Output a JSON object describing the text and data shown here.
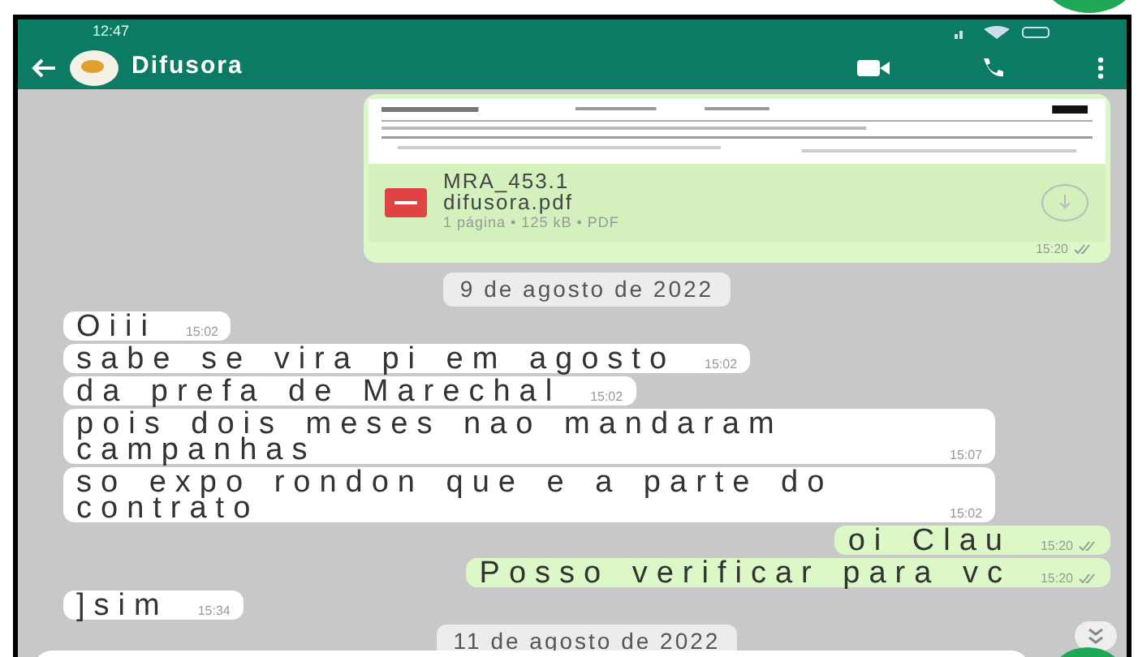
{
  "status_bar": {
    "time": "12:47"
  },
  "header": {
    "title": "Difusora"
  },
  "messages": [
    {
      "kind": "document",
      "outgoing": true,
      "name_line1": "MRA_453.1",
      "name_line2": "difusora.pdf",
      "meta": "1 página • 125 kB • PDF",
      "time": "15:20"
    },
    {
      "kind": "date",
      "text": "9 de agosto de 2022"
    },
    {
      "kind": "text",
      "outgoing": false,
      "text": "Oiii",
      "time": "15:02"
    },
    {
      "kind": "text",
      "outgoing": false,
      "text": "sabe se vira pi em agosto",
      "time": "15:02"
    },
    {
      "kind": "text",
      "outgoing": false,
      "text": "da prefa de Marechal",
      "time": "15:02"
    },
    {
      "kind": "text",
      "outgoing": false,
      "text": "pois dois meses nao mandaram campanhas",
      "time": "15:07"
    },
    {
      "kind": "text",
      "outgoing": false,
      "text": "so expo rondon que e a parte do contrato",
      "time": "15:02"
    },
    {
      "kind": "text",
      "outgoing": true,
      "text": "oi Clau",
      "time": "15:20"
    },
    {
      "kind": "text",
      "outgoing": true,
      "text": "Posso verificar para vc",
      "time": "15:20"
    },
    {
      "kind": "text",
      "outgoing": false,
      "text": "]sim",
      "time": "15:34"
    },
    {
      "kind": "date",
      "text": "11 de agosto de 2022"
    }
  ]
}
